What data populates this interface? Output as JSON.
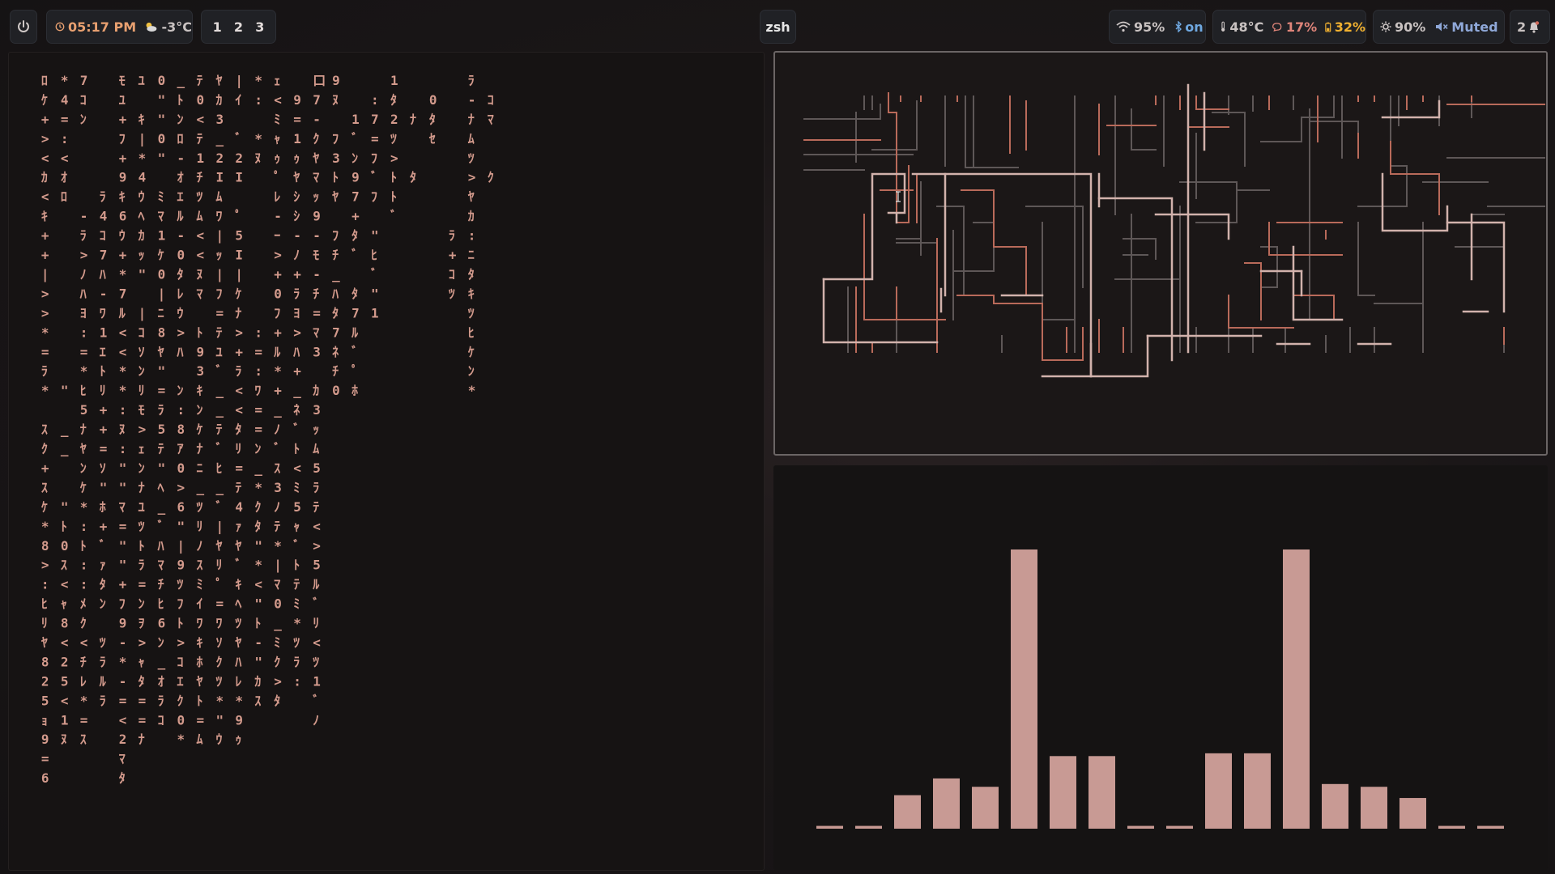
{
  "topbar": {
    "power_icon": "power-icon",
    "clock_icon": "clock-icon",
    "time": "05:17 PM",
    "weather_icon": "partly-cloudy-icon",
    "weather": "-3°C",
    "workspaces": [
      "1",
      "2",
      "3"
    ],
    "window_title": "zsh",
    "wifi_icon": "wifi-icon",
    "wifi": "95%",
    "bluetooth_icon": "bluetooth-icon",
    "bluetooth": "on",
    "temp_icon": "thermometer-icon",
    "temp": "48°C",
    "cpu_icon": "cpu-icon",
    "cpu": "17%",
    "battery_icon": "battery-icon",
    "battery": "32%",
    "brightness_icon": "brightness-icon",
    "brightness": "90%",
    "volume_icon": "speaker-muted-icon",
    "volume": "Muted",
    "notifications_icon": "bell-icon",
    "notifications": "2"
  },
  "matrix": {
    "color": "#d39a8c",
    "columns": [
      "ﾛｹ+><ｶ<ｷ++|>>*=ﾗ* ｽｸ+ｽｹ*8>:ﾋﾘﾔ825ｮ9=6",
      "*4=:<ｵﾛ         \" __  \"ﾄ0ｽ<ｬ8<25<1ﾇ",
      "7ｺﾝ    -ﾗ>ﾉﾊﾖ:=*ﾋ5ﾅﾔﾝｹ*:ﾄ::ﾒｸ<ﾁﾚ*=ｽ",
      "      ﾗ4ｺ7ﾊ-ﾜ1ｴﾄﾘ++=ｿ\"ﾎ+ﾞｧﾀﾝ ﾂﾗﾙﾗ  ",
      "ﾓﾕ+ﾌ+9ｷ6ｳ+*7ﾙ<<**:ﾇ:\"\"ﾏ=\"\"+ﾌ9-*-=<2ﾏﾀ",
      "ﾕ ｷ|*4ｳﾍｶｯ\" |ｺｿﾝﾘﾓ>ｪﾝﾅﾕﾂﾄﾗ=ﾝｦ>ｬﾀ==ﾅ",
      "0\"\"0\" ﾐﾏ1ｹ0|ﾆ8ﾔ\"=ﾗ5ﾃ\"ﾍ_ﾞﾊﾏﾁﾋ6ﾝ_ｵﾗｺ",
      "_ﾄﾝﾛ-ｵｴﾙ-0ﾀﾚｳ>ﾊ ﾝ:8ｱ0>6\"|9ﾂﾌﾄ>ｺｴｸ0*",
      "ﾃ0<ﾃ1ﾁﾂﾑ<<ﾇﾏ ﾄ93ｷﾝｹﾅﾆ_ﾂﾘﾉｽﾐｲﾜｷﾎﾔﾄ=ﾑ",
      "ﾔｶ3_2Iﾑﾜ|ｯ|ﾌ=ﾃﾕﾞ__ﾃﾞﾋ_ﾞ|ﾔﾘﾟ=ﾜｿｸﾂ*\"ｳ",
      "|ｲ ﾞ2I ﾟ5I|ｹﾅ>+ﾗ<<ﾀﾘ=ﾃ4ｧﾔﾞｷﾍﾂﾔﾊﾚ*9ｩ",
      "*: *ﾇ        :=:ﾜ==ﾝ_*ｸﾀ\"*<\"ﾄ-\"ｶｽ",
      "ｪ<ﾐｬｩﾟﾚ-ｰ>+0ﾌ+ﾙ*+_ﾉﾞｽ3ﾉﾃ*|ﾏ0_ﾐｸ>ﾀ",
      " 9=1ｩﾔｼｼ-ﾉ+ﾗﾖ>ﾊ+_ﾈﾞﾄ<ﾐ5ｬﾞﾄﾃﾐ*ﾂﾗ:",
      "口7-ｸﾔﾏｯ9-ﾓ-ﾁ=ﾏ3 ｶ3ｯﾑ5ﾗﾃ<>5ﾙﾞﾘ<ﾂ1ﾞﾉ",
      "9ﾇ ﾌ3ﾄﾔ ﾌﾁ_ﾊﾀ7ﾈﾁ0",
      "  1ﾞﾝ97+ﾀﾞ ﾀ7ﾙﾞﾟﾎ",
      " :7=ﾌﾞﾌ \"ﾋﾞ\"1",
      "1ﾀ2ﾂ>ﾄﾄﾞ",
      "  ﾅ  ﾀ",
      " 0ﾀｾ",
      "        ﾗ+ｺﾂ",
      "ﾗ-ﾅﾑﾂ>ﾔｶ:ﾆﾀｷﾂﾋｹﾝ*",
      " ｺﾏ  ｸ"
    ]
  },
  "visualizer": {
    "bar_color": "#c89a94",
    "levels": [
      0.01,
      0.01,
      0.12,
      0.18,
      0.15,
      1.0,
      0.26,
      0.26,
      0.01,
      0.01,
      0.27,
      0.27,
      1.0,
      0.16,
      0.15,
      0.11,
      0.01,
      0.01
    ]
  }
}
